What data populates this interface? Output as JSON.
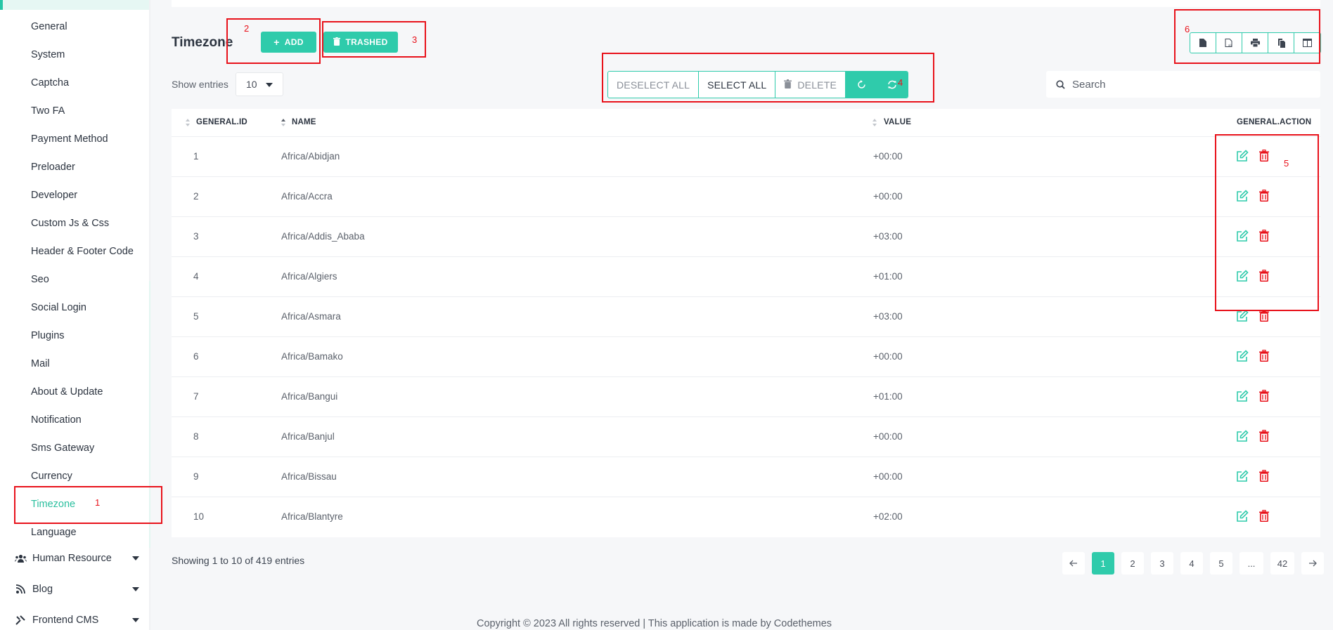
{
  "sidebar": {
    "items": [
      {
        "label": "General"
      },
      {
        "label": "System"
      },
      {
        "label": "Captcha"
      },
      {
        "label": "Two FA"
      },
      {
        "label": "Payment Method"
      },
      {
        "label": "Preloader"
      },
      {
        "label": "Developer"
      },
      {
        "label": "Custom Js & Css"
      },
      {
        "label": "Header & Footer Code"
      },
      {
        "label": "Seo"
      },
      {
        "label": "Social Login"
      },
      {
        "label": "Plugins"
      },
      {
        "label": "Mail"
      },
      {
        "label": "About & Update"
      },
      {
        "label": "Notification"
      },
      {
        "label": "Sms Gateway"
      },
      {
        "label": "Currency"
      },
      {
        "label": "Timezone",
        "active": true
      },
      {
        "label": "Language"
      }
    ],
    "groups": [
      {
        "label": "Human Resource",
        "icon": "users-icon"
      },
      {
        "label": "Blog",
        "icon": "blog-icon"
      },
      {
        "label": "Frontend CMS",
        "icon": "tools-icon"
      }
    ]
  },
  "page": {
    "title": "Timezone",
    "add_label": "ADD",
    "trashed_label": "TRASHED"
  },
  "toolbar": {
    "show_entries_label": "Show entries",
    "entries_value": "10",
    "deselect_all": "DESELECT ALL",
    "select_all": "SELECT ALL",
    "delete": "DELETE",
    "search_placeholder": "Search"
  },
  "export_buttons": [
    "csv-icon",
    "excel-icon",
    "print-icon",
    "copy-icon",
    "columns-icon"
  ],
  "table": {
    "columns": [
      "GENERAL.ID",
      "NAME",
      "VALUE",
      "GENERAL.ACTION"
    ],
    "rows": [
      {
        "id": "1",
        "name": "Africa/Abidjan",
        "value": "+00:00"
      },
      {
        "id": "2",
        "name": "Africa/Accra",
        "value": "+00:00"
      },
      {
        "id": "3",
        "name": "Africa/Addis_Ababa",
        "value": "+03:00"
      },
      {
        "id": "4",
        "name": "Africa/Algiers",
        "value": "+01:00"
      },
      {
        "id": "5",
        "name": "Africa/Asmara",
        "value": "+03:00"
      },
      {
        "id": "6",
        "name": "Africa/Bamako",
        "value": "+00:00"
      },
      {
        "id": "7",
        "name": "Africa/Bangui",
        "value": "+01:00"
      },
      {
        "id": "8",
        "name": "Africa/Banjul",
        "value": "+00:00"
      },
      {
        "id": "9",
        "name": "Africa/Bissau",
        "value": "+00:00"
      },
      {
        "id": "10",
        "name": "Africa/Blantyre",
        "value": "+02:00"
      }
    ]
  },
  "footer": {
    "showing": "Showing 1 to 10 of 419 entries",
    "pages": [
      "1",
      "2",
      "3",
      "4",
      "5",
      "...",
      "42"
    ],
    "current_page": "1",
    "copyright": "Copyright © 2023 All rights reserved | This application is made by Codethemes"
  },
  "annotations": [
    "1",
    "2",
    "3",
    "4",
    "5",
    "6"
  ],
  "colors": {
    "accent": "#2fcbab",
    "danger": "#e8121b",
    "annotation": "#e8121b"
  }
}
